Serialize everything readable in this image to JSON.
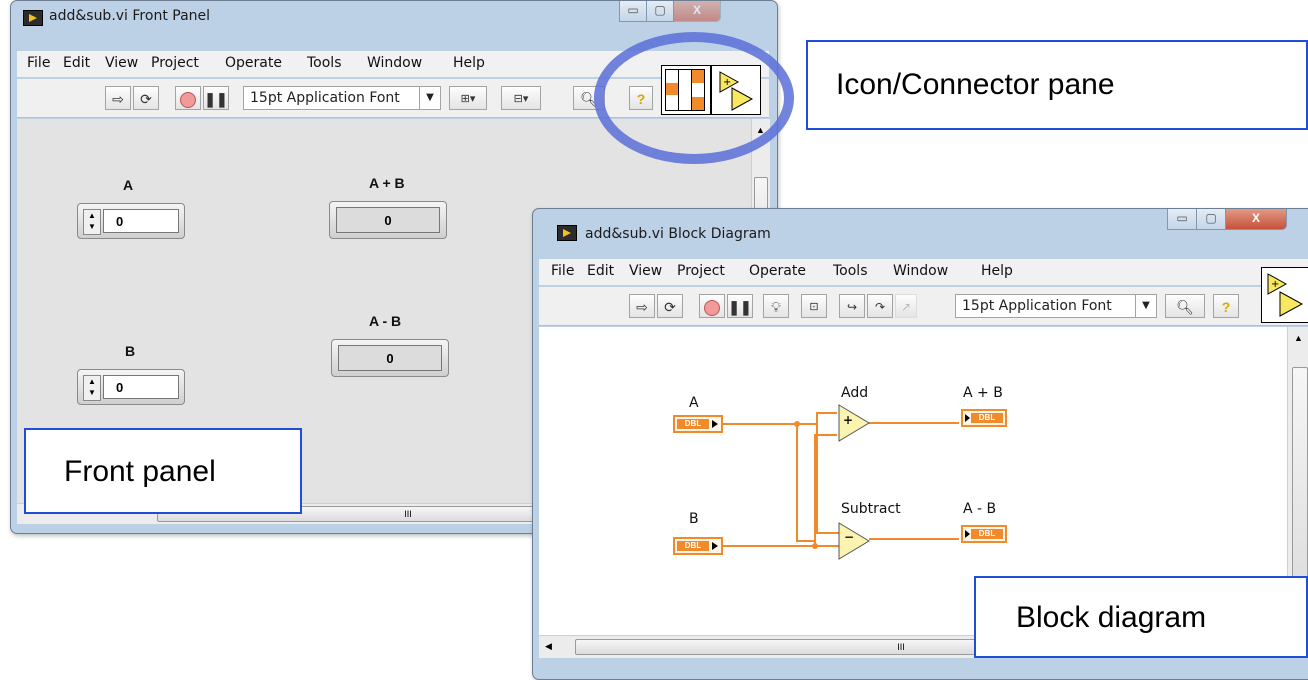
{
  "front_panel": {
    "title": "add&sub.vi Front Panel",
    "menu": [
      "File",
      "Edit",
      "View",
      "Project",
      "Operate",
      "Tools",
      "Window",
      "Help"
    ],
    "font_select": "15pt Application Font",
    "controls": [
      {
        "label": "A",
        "value": "0"
      },
      {
        "label": "B",
        "value": "0"
      }
    ],
    "indicators": [
      {
        "label": "A + B",
        "value": "0"
      },
      {
        "label": "A - B",
        "value": "0"
      }
    ],
    "scroll_glyph": "III"
  },
  "block_diagram": {
    "title": "add&sub.vi Block Diagram",
    "menu": [
      "File",
      "Edit",
      "View",
      "Project",
      "Operate",
      "Tools",
      "Window",
      "Help"
    ],
    "font_select": "15pt Application Font",
    "inputs": [
      {
        "label": "A",
        "type": "DBL"
      },
      {
        "label": "B",
        "type": "DBL"
      }
    ],
    "functions": [
      {
        "label": "Add",
        "symbol": "+"
      },
      {
        "label": "Subtract",
        "symbol": "−"
      }
    ],
    "outputs": [
      {
        "label": "A + B",
        "type": "DBL"
      },
      {
        "label": "A - B",
        "type": "DBL"
      }
    ],
    "scroll_glyph": "III",
    "wire_color": "#f08a2b"
  },
  "callouts": {
    "icon_connector": "Icon/Connector pane",
    "front_panel": "Front panel",
    "block_diagram": "Block diagram"
  },
  "colors": {
    "callout_border": "#1f4fd6",
    "highlight_ellipse": "#5b6fd8",
    "labview_orange": "#f08a2b"
  }
}
